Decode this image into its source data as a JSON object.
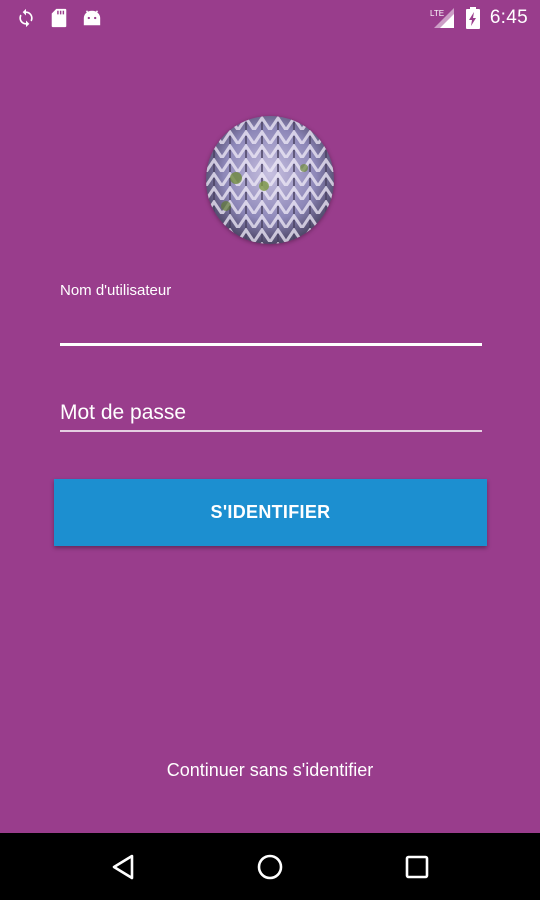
{
  "status_bar": {
    "left_icons": [
      "sync-icon",
      "sd-card-icon",
      "android-icon"
    ],
    "right_icons": [
      "lte-signal-icon",
      "battery-charging-icon"
    ],
    "network_label": "LTE",
    "time": "6:45"
  },
  "login": {
    "avatar_icon": "profile-avatar-image",
    "username_label": "Nom d'utilisateur",
    "username_value": "",
    "password_placeholder": "Mot de passe",
    "password_value": "",
    "submit_label": "S'IDENTIFIER",
    "continue_label": "Continuer sans s'identifier"
  },
  "navigation": {
    "icons": [
      "back-icon",
      "home-icon",
      "recents-icon"
    ]
  },
  "colors": {
    "background": "#993d8c",
    "button": "#1c8fd0",
    "nav_bar": "#000000",
    "text": "#ffffff"
  }
}
